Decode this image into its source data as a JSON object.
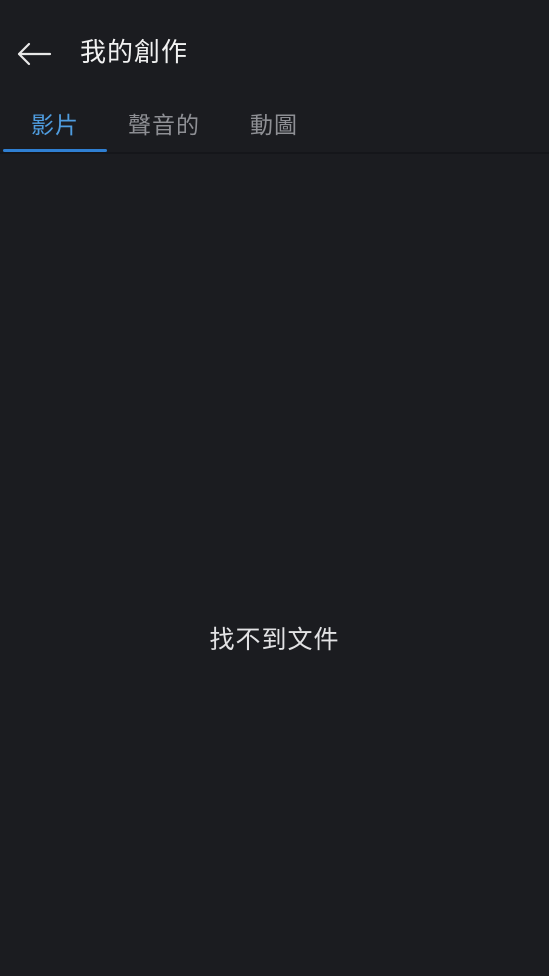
{
  "header": {
    "title": "我的創作",
    "back_icon": "arrow-left-icon"
  },
  "tabs": [
    {
      "label": "影片",
      "active": true
    },
    {
      "label": "聲音的",
      "active": false
    },
    {
      "label": "動圖",
      "active": false
    }
  ],
  "content": {
    "empty_message": "找不到文件"
  },
  "colors": {
    "background": "#1b1c20",
    "accent": "#2f7fd2",
    "active_tab_text": "#4f9de0",
    "inactive_tab_text": "#8e8f94"
  }
}
